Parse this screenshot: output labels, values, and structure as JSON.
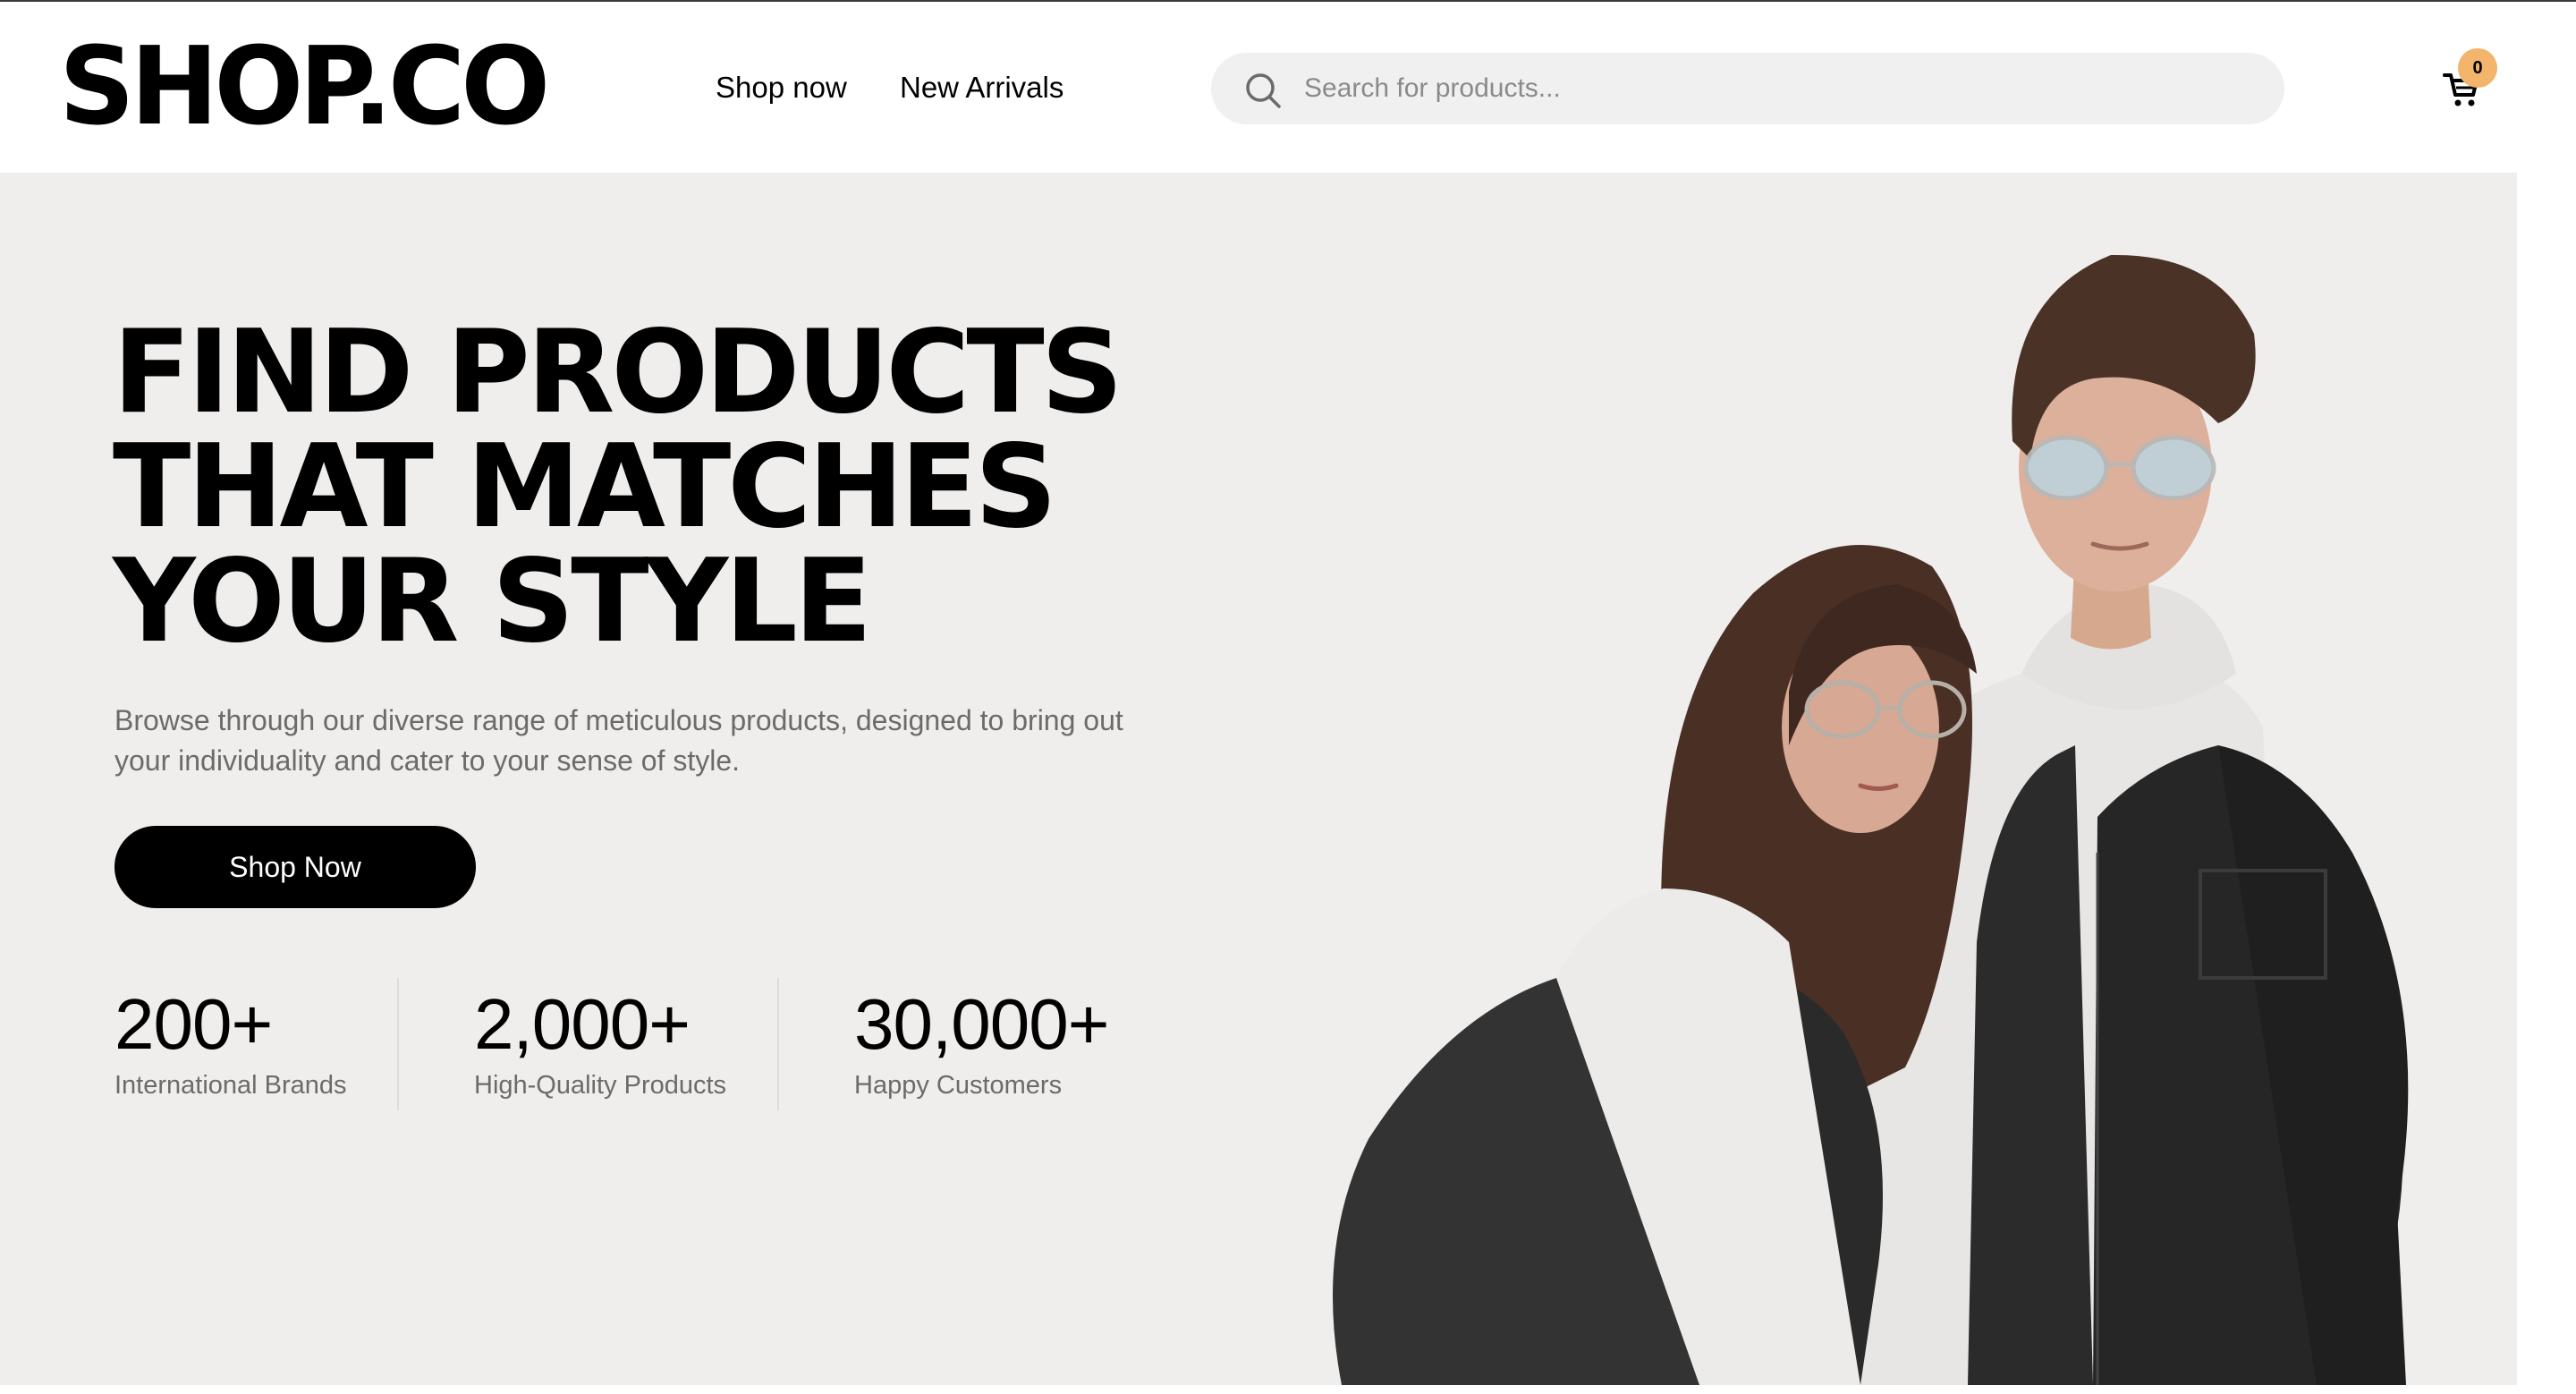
{
  "header": {
    "logo": "SHOP.CO",
    "nav": [
      {
        "label": "Shop now"
      },
      {
        "label": "New Arrivals"
      }
    ],
    "search": {
      "placeholder": "Search for products...",
      "icon": "search-icon"
    },
    "cart": {
      "icon": "cart-icon",
      "count": "0",
      "badge_color": "#f2b56b"
    }
  },
  "hero": {
    "headline": [
      "FIND PRODUCTS",
      "THAT MATCHES",
      "YOUR STYLE"
    ],
    "subtext": "Browse through our diverse range of meticulous products, designed to bring out your individuality and cater to your sense of style.",
    "cta_label": "Shop Now",
    "stats": [
      {
        "value": "200+",
        "label": "International Brands"
      },
      {
        "value": "2,000+",
        "label": "High-Quality Products"
      },
      {
        "value": "30,000+",
        "label": "Happy Customers"
      }
    ],
    "image": "couple-in-denim-jackets-photo",
    "background": "#f0eeed"
  }
}
